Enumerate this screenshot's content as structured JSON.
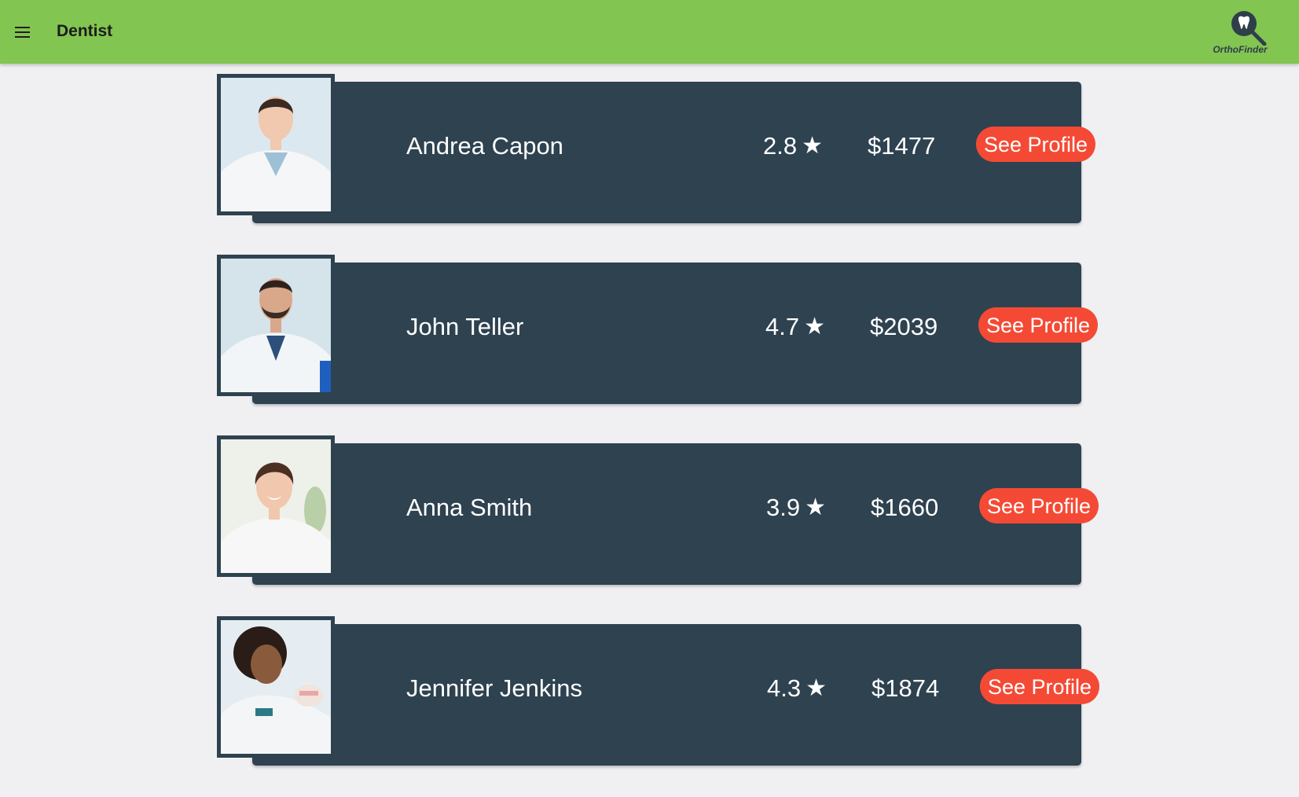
{
  "app_bar": {
    "title": "Dentist",
    "logo_text": "OrthoFinder",
    "color": "#82c551"
  },
  "icons": {
    "menu": "hamburger-menu-icon",
    "logo": "tooth-magnifier-logo",
    "rating": "star-icon"
  },
  "colors": {
    "card_bg": "#2e4250",
    "button_bg": "#f44a35",
    "page_bg": "#f0f0f3"
  },
  "dentists": [
    {
      "name": "Andrea Capon",
      "rating": "2.8",
      "price": "$1477",
      "button_label": "See Profile"
    },
    {
      "name": "John Teller",
      "rating": "4.7",
      "price": "$2039",
      "button_label": "See Profile"
    },
    {
      "name": "Anna Smith",
      "rating": "3.9",
      "price": "$1660",
      "button_label": "See Profile"
    },
    {
      "name": "Jennifer Jenkins",
      "rating": "4.3",
      "price": "$1874",
      "button_label": "See Profile"
    }
  ],
  "star_glyph": "★"
}
